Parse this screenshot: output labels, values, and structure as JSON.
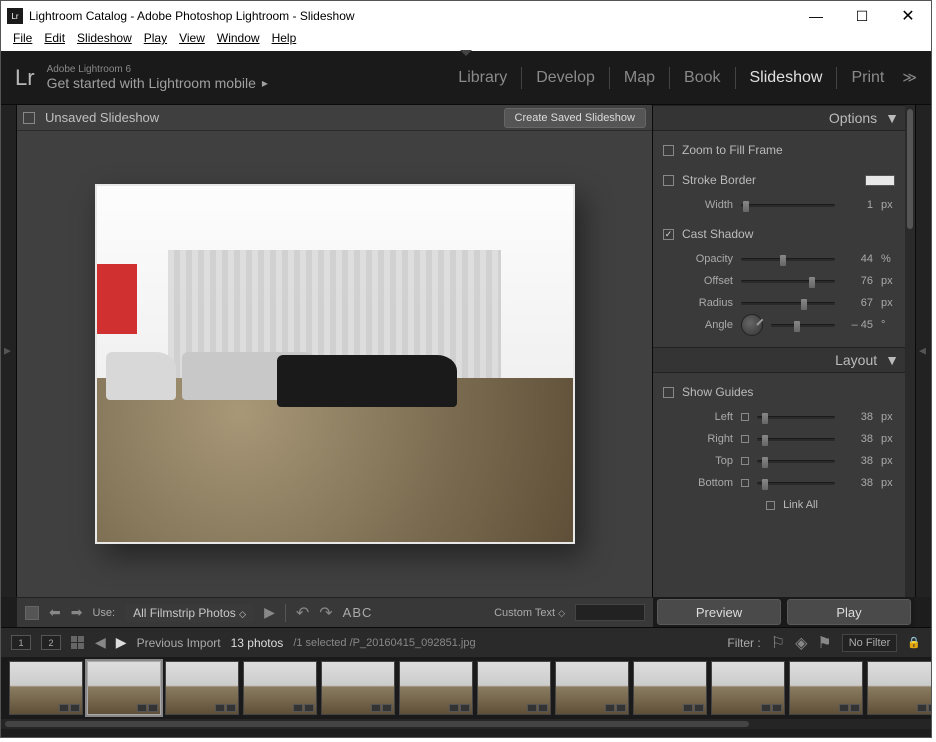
{
  "window": {
    "title": "Lightroom Catalog - Adobe Photoshop Lightroom - Slideshow",
    "app_icon": "Lr"
  },
  "menu": [
    "File",
    "Edit",
    "Slideshow",
    "Play",
    "View",
    "Window",
    "Help"
  ],
  "header": {
    "logo": "Lr",
    "brand_top": "Adobe Lightroom 6",
    "brand_bot": "Get started with Lightroom mobile",
    "modules": [
      "Library",
      "Develop",
      "Map",
      "Book",
      "Slideshow",
      "Print"
    ],
    "active": "Slideshow"
  },
  "center": {
    "title": "Unsaved Slideshow",
    "create_btn": "Create Saved Slideshow"
  },
  "panels": {
    "options": {
      "title": "Options",
      "zoom_fill": "Zoom to Fill Frame",
      "stroke_border": "Stroke Border",
      "width_label": "Width",
      "width_val": "1",
      "width_unit": "px",
      "cast_shadow": "Cast Shadow",
      "opacity_label": "Opacity",
      "opacity_val": "44",
      "opacity_unit": "%",
      "offset_label": "Offset",
      "offset_val": "76",
      "offset_unit": "px",
      "radius_label": "Radius",
      "radius_val": "67",
      "radius_unit": "px",
      "angle_label": "Angle",
      "angle_val": "– 45",
      "angle_unit": "°"
    },
    "layout": {
      "title": "Layout",
      "show_guides": "Show Guides",
      "left_label": "Left",
      "left_val": "38",
      "left_unit": "px",
      "right_label": "Right",
      "right_val": "38",
      "right_unit": "px",
      "top_label": "Top",
      "top_val": "38",
      "top_unit": "px",
      "bottom_label": "Bottom",
      "bottom_val": "38",
      "bottom_unit": "px",
      "link_all": "Link All"
    }
  },
  "toolbar": {
    "use_label": "Use:",
    "use_value": "All Filmstrip Photos",
    "abc": "ABC",
    "custom_text": "Custom Text",
    "preview_btn": "Preview",
    "play_btn": "Play"
  },
  "filmstrip_hdr": {
    "display1": "1",
    "display2": "2",
    "source": "Previous Import",
    "count": "13 photos",
    "selected": "/1 selected /P_20160415_092851.jpg",
    "filter_label": "Filter :",
    "filter_value": "No Filter"
  }
}
